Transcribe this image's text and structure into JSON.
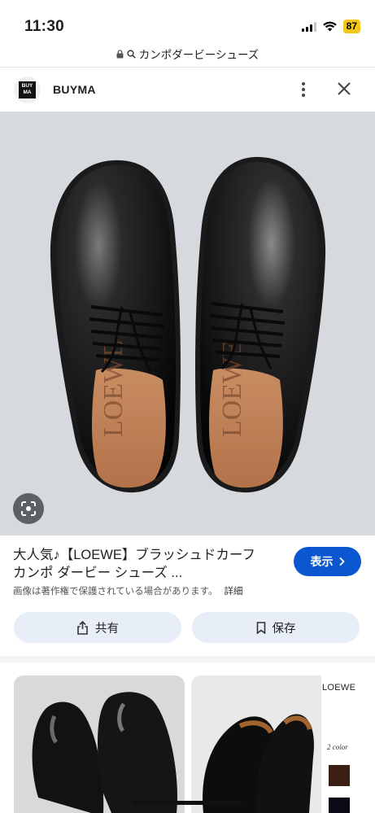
{
  "status_bar": {
    "time": "11:30",
    "battery": "87"
  },
  "url_bar": {
    "text": "カンポダービーシューズ"
  },
  "site": {
    "name": "BUYMA",
    "logo_text_top": "BUY",
    "logo_text_bottom": "MA"
  },
  "hero": {
    "insole_brand": "LOEWE"
  },
  "result": {
    "title_line1": "大人気♪【LOEWE】ブラッシュドカーフ",
    "title_line2": "カンポ ダービー シューズ ...",
    "show_label": "表示",
    "copyright_note": "画像は著作権で保護されている場合があります。",
    "details_label": "詳細",
    "share_label": "共有",
    "save_label": "保存"
  },
  "related": {
    "brand_label": "LOEWE",
    "color_label": "2 color"
  },
  "icons": [
    "lock-icon",
    "search-icon",
    "more-vert-icon",
    "close-icon",
    "lens-icon",
    "chevron-right-icon",
    "share-icon",
    "bookmark-icon"
  ],
  "colors": {
    "accent": "#0b57d0",
    "action_bg": "#e8eef8",
    "hero_bg": "#d6dade",
    "battery": "#f5c518"
  }
}
